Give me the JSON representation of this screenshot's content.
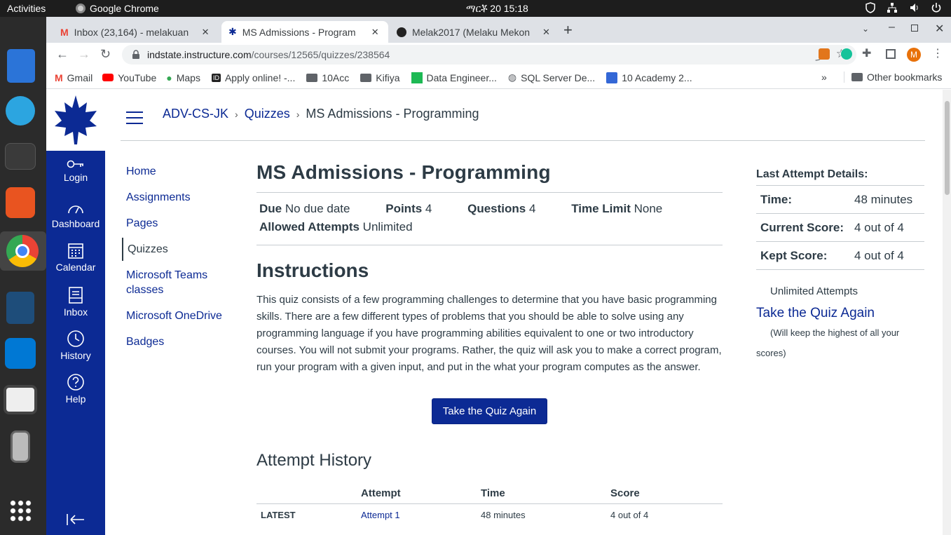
{
  "os": {
    "activities": "Activities",
    "app_name": "Google Chrome",
    "clock": "ማርቾ 20  15:18"
  },
  "browser": {
    "tabs": [
      {
        "title": "Inbox (23,164) - melakuan",
        "favicon": "gmail-icon"
      },
      {
        "title": "MS Admissions - Program",
        "favicon": "canvas-icon"
      },
      {
        "title": "Melak2017 (Melaku Mekon",
        "favicon": "github-icon"
      }
    ],
    "url_host": "indstate.instructure.com",
    "url_path": "/courses/12565/quizzes/238564",
    "profile_initial": "M",
    "bookmarks": [
      "Gmail",
      "YouTube",
      "Maps",
      "Apply online! -...",
      "10Acc",
      "Kifiya",
      "Data Engineer...",
      "SQL Server De...",
      "10 Academy 2..."
    ],
    "other_bookmarks": "Other bookmarks"
  },
  "global_nav": [
    {
      "label": "Login",
      "icon": "key-icon"
    },
    {
      "label": "Dashboard",
      "icon": "dashboard-icon"
    },
    {
      "label": "Calendar",
      "icon": "calendar-icon"
    },
    {
      "label": "Inbox",
      "icon": "inbox-icon"
    },
    {
      "label": "History",
      "icon": "clock-icon"
    },
    {
      "label": "Help",
      "icon": "help-icon"
    }
  ],
  "breadcrumb": [
    "ADV-CS-JK",
    "Quizzes",
    "MS Admissions - Programming"
  ],
  "course_nav": [
    "Home",
    "Assignments",
    "Pages",
    "Quizzes",
    "Microsoft Teams classes",
    "Microsoft OneDrive",
    "Badges"
  ],
  "quiz": {
    "title": "MS Admissions - Programming",
    "meta": {
      "due_label": "Due",
      "due_value": "No due date",
      "points_label": "Points",
      "points_value": "4",
      "questions_label": "Questions",
      "questions_value": "4",
      "time_limit_label": "Time Limit",
      "time_limit_value": "None",
      "attempts_label": "Allowed Attempts",
      "attempts_value": "Unlimited"
    },
    "instructions_heading": "Instructions",
    "instructions_text": "This quiz consists of a few programming challenges to determine that you have basic programming skills. There are a few different types of problems that you should be able to solve using any programming language if you have programming abilities equivalent to one or two introductory courses. You will not submit your programs. Rather, the quiz will ask you to make a correct program, run your program with a given input, and put in the what your program computes as the answer.",
    "take_button": "Take the Quiz Again",
    "history_heading": "Attempt History",
    "history_columns": [
      "",
      "Attempt",
      "Time",
      "Score"
    ],
    "history_rows": [
      {
        "label": "LATEST",
        "attempt": "Attempt 1",
        "time": "48 minutes",
        "score": "4 out of 4"
      }
    ]
  },
  "sidebar": {
    "heading": "Last Attempt Details:",
    "rows": [
      {
        "key": "Time:",
        "value": "48 minutes"
      },
      {
        "key": "Current Score:",
        "value": "4 out of 4"
      },
      {
        "key": "Kept Score:",
        "value": "4 out of 4"
      }
    ],
    "unlimited": "Unlimited Attempts",
    "take_link": "Take the Quiz Again",
    "note": "(Will keep the highest of all your scores)"
  },
  "colors": {
    "canvas_blue": "#0c2a94",
    "text": "#2d3b45"
  }
}
